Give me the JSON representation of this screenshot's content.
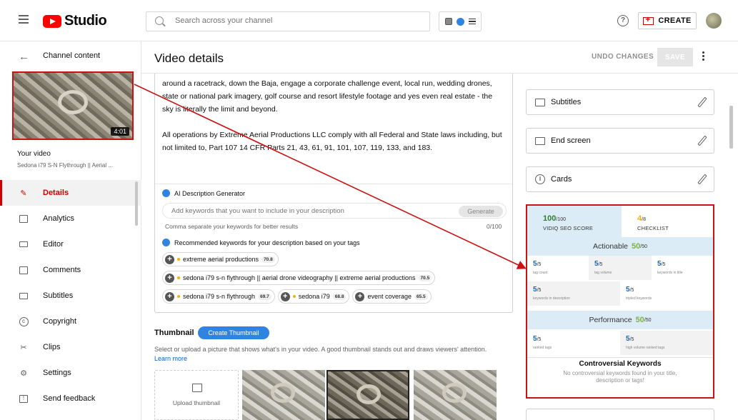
{
  "header": {
    "logo_text": "Studio",
    "search_placeholder": "Search across your channel",
    "help_glyph": "?",
    "create_label": "CREATE"
  },
  "sidebar": {
    "back_label": "Channel content",
    "duration": "4:01",
    "your_video_label": "Your video",
    "video_name": "Sedona i79 S-N Flythrough || Aerial ...",
    "items": [
      {
        "label": "Details",
        "icon": "pencil-icon"
      },
      {
        "label": "Analytics",
        "icon": "analytics-icon"
      },
      {
        "label": "Editor",
        "icon": "editor-icon"
      },
      {
        "label": "Comments",
        "icon": "comments-icon"
      },
      {
        "label": "Subtitles",
        "icon": "subtitles-icon"
      },
      {
        "label": "Copyright",
        "icon": "copyright-icon"
      },
      {
        "label": "Clips",
        "icon": "scissors-icon"
      },
      {
        "label": "Settings",
        "icon": "gear-icon"
      },
      {
        "label": "Send feedback",
        "icon": "feedback-icon"
      }
    ]
  },
  "main": {
    "title": "Video details",
    "undo_label": "UNDO CHANGES",
    "save_label": "SAVE",
    "description": {
      "paragraph1": "around a racetrack, down the Baja, engage a corporate challenge event, local run, wedding drones, state or national park imagery, golf course and resort lifestyle footage and yes even real estate - the sky is literally the limit and beyond.",
      "paragraph2": "All operations by Extreme Aerial Productions LLC comply with all Federal and State laws including, but not limited to, Part 107 14 CFR Parts 21, 43, 61, 91, 101, 107, 119, 133, and 183."
    },
    "ai_generator": {
      "title": "AI Description Generator",
      "input_placeholder": "Add keywords that you want to include in your description",
      "generate_label": "Generate",
      "hint": "Comma separate your keywords for better results",
      "count": "0/100",
      "recommended_title": "Recommended keywords for your description based on your tags",
      "keywords": [
        {
          "text": "extreme aerial productions",
          "score": "70.8"
        },
        {
          "text": "sedona i79 s-n flythrough || aerial drone videography || extreme aerial productions",
          "score": "70.5"
        },
        {
          "text": "sedona i79 s-n flythrough",
          "score": "69.7"
        },
        {
          "text": "sedona i79",
          "score": "68.8"
        },
        {
          "text": "event coverage",
          "score": "65.5"
        }
      ]
    },
    "thumbnail": {
      "title": "Thumbnail",
      "create_label": "Create Thumbnail",
      "description": "Select or upload a picture that shows what's in your video. A good thumbnail stands out and draws viewers' attention.",
      "learn_more": "Learn more",
      "upload_label": "Upload thumbnail"
    }
  },
  "right": {
    "cards": [
      {
        "label": "Subtitles"
      },
      {
        "label": "End screen"
      },
      {
        "label": "Cards"
      }
    ],
    "vidiq": {
      "seo_score": "100",
      "seo_max": "/100",
      "seo_label": "VIDIQ SEO SCORE",
      "checklist_score": "4",
      "checklist_max": "/8",
      "checklist_label": "CHECKLIST",
      "actionable_label": "Actionable",
      "actionable_score": "50",
      "actionable_max": "/50",
      "actionable_items": [
        {
          "value": "5",
          "max": "/5",
          "label": "tag count"
        },
        {
          "value": "5",
          "max": "/5",
          "label": "tag volume"
        },
        {
          "value": "5",
          "max": "/5",
          "label": "keywords in title"
        },
        {
          "value": "5",
          "max": "/5",
          "label": "keywords in description"
        },
        {
          "value": "5",
          "max": "/5",
          "label": "tripled keywords"
        }
      ],
      "performance_label": "Performance",
      "performance_score": "50",
      "performance_max": "/50",
      "performance_items": [
        {
          "value": "5",
          "max": "/5",
          "label": "ranked tags"
        },
        {
          "value": "5",
          "max": "/5",
          "label": "high volume ranked tags"
        }
      ],
      "controversial_title": "Controversial Keywords",
      "controversial_text": "No controversial keywords found in your title, description or tags!"
    }
  },
  "colors": {
    "brand_red": "#ff0000",
    "active_red": "#cc0000",
    "annotation_red": "#cc1111",
    "vidiq_blue": "#2f84e2",
    "score_green": "#2e7d32",
    "section_green": "#7cb342",
    "checklist_yellow": "#f6b100"
  }
}
